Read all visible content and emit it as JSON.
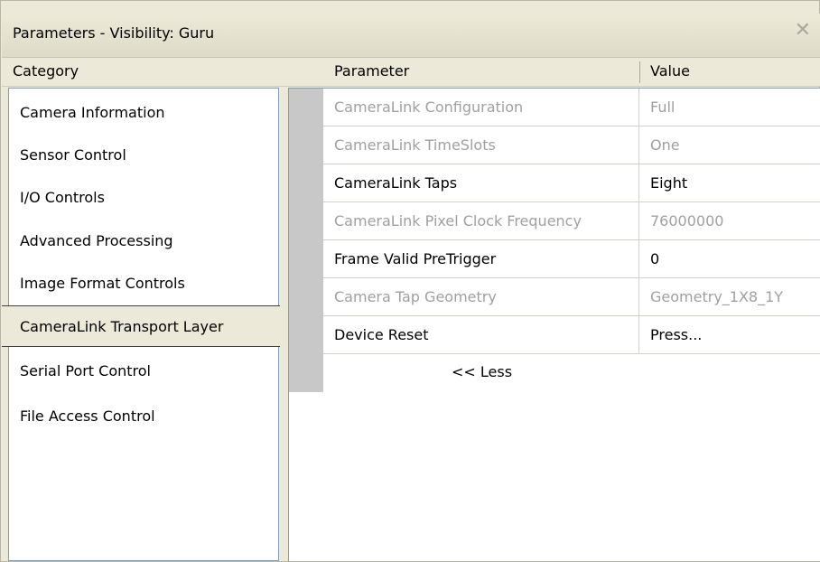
{
  "window": {
    "title": "Parameters - Visibility: Guru",
    "close_glyph": "✕"
  },
  "headers": {
    "category": "Category",
    "parameter": "Parameter",
    "value": "Value"
  },
  "categories": [
    {
      "label": "Camera Information",
      "selected": false
    },
    {
      "label": "Sensor Control",
      "selected": false
    },
    {
      "label": "I/O Controls",
      "selected": false
    },
    {
      "label": "Advanced Processing",
      "selected": false
    },
    {
      "label": "Image Format Controls",
      "selected": false
    },
    {
      "label": "CameraLink Transport Layer",
      "selected": true
    },
    {
      "label": "Serial Port Control",
      "selected": false
    },
    {
      "label": "File Access Control",
      "selected": false
    }
  ],
  "parameters": [
    {
      "name": "CameraLink Configuration",
      "value": "Full",
      "enabled": false
    },
    {
      "name": "CameraLink TimeSlots",
      "value": "One",
      "enabled": false
    },
    {
      "name": "CameraLink Taps",
      "value": "Eight",
      "enabled": true
    },
    {
      "name": "CameraLink Pixel Clock Frequency",
      "value": "76000000",
      "enabled": false
    },
    {
      "name": "Frame Valid PreTrigger",
      "value": "0",
      "enabled": true
    },
    {
      "name": "Camera Tap Geometry",
      "value": "Geometry_1X8_1Y",
      "enabled": false
    },
    {
      "name": "Device Reset",
      "value": "Press...",
      "enabled": true
    }
  ],
  "less_button": "<< Less"
}
